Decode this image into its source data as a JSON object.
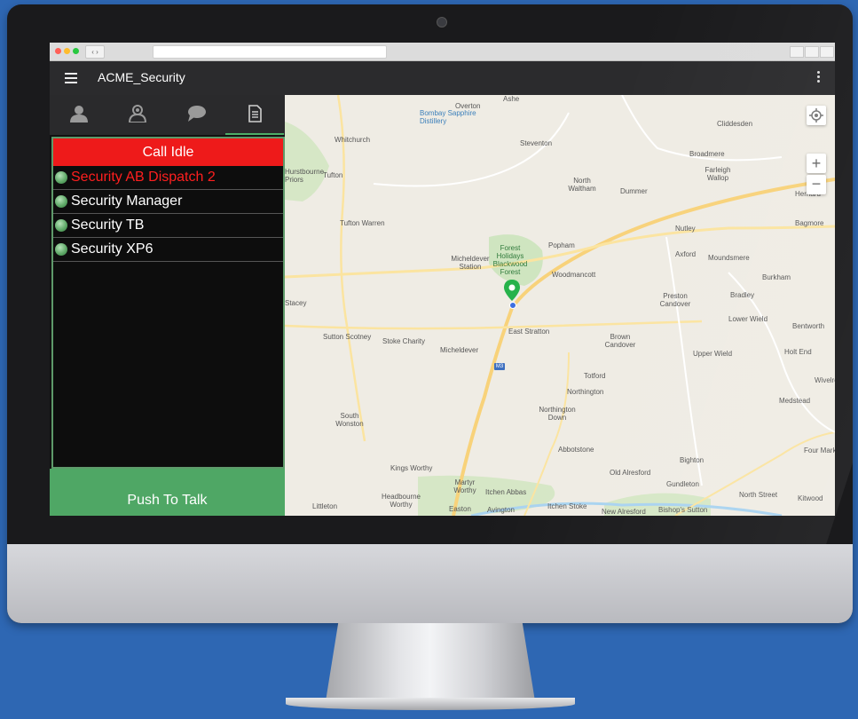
{
  "app": {
    "title": "ACME_Security"
  },
  "tabs": [
    {
      "icon": "person-icon"
    },
    {
      "icon": "group-icon"
    },
    {
      "icon": "chat-icon"
    },
    {
      "icon": "document-icon",
      "active": true
    }
  ],
  "call_status": "Call Idle",
  "contacts": [
    {
      "name": "Security AB Dispatch 2",
      "active": true
    },
    {
      "name": "Security Manager"
    },
    {
      "name": "Security TB"
    },
    {
      "name": "Security XP6"
    }
  ],
  "push_to_talk": "Push To Talk",
  "map": {
    "zoom_in": "+",
    "zoom_out": "−",
    "road_shield": "M3",
    "places": [
      "Overton",
      "Ashe",
      "Bombay Sapphire Distillery",
      "Whitchurch",
      "Steventon",
      "Cliddesden",
      "Hurstbourne Priors",
      "Tufton",
      "North Waltham",
      "Dummer",
      "Broadmere",
      "Farleigh Wallop",
      "Herriard",
      "Nutley",
      "Bagmore",
      "Tufton Warren",
      "Popham",
      "Axford",
      "Moundsmere",
      "Micheldever Station",
      "Forest Holidays Blackwood Forest",
      "Woodmancott",
      "Burkham",
      "Preston Candover",
      "Bradley",
      "Stacey",
      "Lower Wield",
      "Bentworth",
      "Sutton Scotney",
      "Stoke Charity",
      "East Stratton",
      "Brown Candover",
      "Upper Wield",
      "Holt End",
      "Micheldever",
      "Totford",
      "Wivelrod",
      "Northington",
      "Medstead",
      "Northington Down",
      "South Wonston",
      "Abbotstone",
      "Bighton",
      "Four Marks",
      "Kings Worthy",
      "Old Alresford",
      "Gundleton",
      "Martyr Worthy",
      "Itchen Abbas",
      "North Street",
      "Kitwood",
      "Littleton",
      "Headbourne Worthy",
      "Easton",
      "Avington",
      "Itchen Stoke",
      "New Alresford",
      "Bishop's Sutton"
    ]
  }
}
